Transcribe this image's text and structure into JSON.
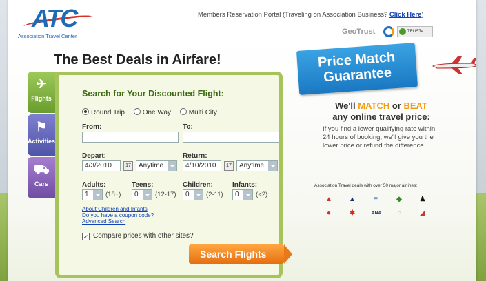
{
  "header": {
    "logo_text": "ATC",
    "logo_tagline": "Association Travel Center",
    "portal_text": "Members Reservation Portal (Traveling on Association Business?",
    "portal_link": "Click Here",
    "portal_close": ")",
    "geotrust": "GeoTrust",
    "truste": "TRUSTe"
  },
  "headline": "The Best Deals in Airfare!",
  "banner": {
    "line1": "Price Match",
    "line2": "Guarantee"
  },
  "tabs": [
    {
      "label": "Flights"
    },
    {
      "label": "Activities"
    },
    {
      "label": "Cars"
    }
  ],
  "search": {
    "title": "Search for Your Discounted Flight:",
    "trip_types": [
      "Round Trip",
      "One Way",
      "Multi City"
    ],
    "selected_trip": "Round Trip",
    "from_label": "From:",
    "to_label": "To:",
    "from_value": "",
    "to_value": "",
    "depart_label": "Depart:",
    "return_label": "Return:",
    "depart_date": "4/3/2010",
    "return_date": "4/10/2010",
    "depart_time": "Anytime",
    "return_time": "Anytime",
    "adults_label": "Adults:",
    "teens_label": "Teens:",
    "children_label": "Children:",
    "infants_label": "Infants:",
    "adults_value": "1",
    "teens_value": "0",
    "children_value": "0",
    "infants_value": "0",
    "adults_hint": "(18+)",
    "teens_hint": "(12-17)",
    "children_hint": "(2-11)",
    "infants_hint": "(<2)",
    "links": [
      "About Children and Infants",
      "Do you have a coupon code?",
      "Advanced Search"
    ],
    "compare_label": "Compare prices with other sites?",
    "compare_checked": true,
    "button": "Search Flights"
  },
  "right": {
    "head_pre": "We'll ",
    "match": "MATCH",
    "or": " or ",
    "beat": "BEAT",
    "head_line2": "any online travel price:",
    "body": "If you find a lower qualifying rate within 24 hours of booking, we'll give you the lower price or refund the difference.",
    "deals": "Association Travel deals with over 50 major airlines:"
  },
  "colors": {
    "accent_orange": "#f39c12",
    "brand_blue": "#1d6bb5",
    "panel_green": "#a6c35c"
  }
}
